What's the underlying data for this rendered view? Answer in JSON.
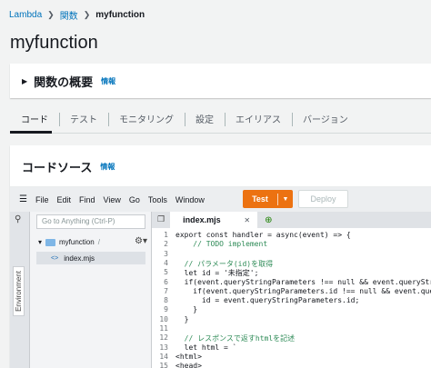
{
  "breadcrumb": {
    "root": "Lambda",
    "functions": "関数",
    "current": "myfunction"
  },
  "page_title": "myfunction",
  "overview": {
    "title": "関数の概要",
    "info": "情報"
  },
  "tabs": [
    "コード",
    "テスト",
    "モニタリング",
    "設定",
    "エイリアス",
    "バージョン"
  ],
  "code_source": {
    "title": "コードソース",
    "info": "情報"
  },
  "ide": {
    "menu": [
      "File",
      "Edit",
      "Find",
      "View",
      "Go",
      "Tools",
      "Window"
    ],
    "test_label": "Test",
    "deploy_label": "Deploy",
    "goto_placeholder": "Go to Anything (Ctrl-P)",
    "environment_label": "Environment",
    "folder_name": "myfunction",
    "folder_slash": "/",
    "file_name": "index.mjs",
    "open_tab": "index.mjs"
  },
  "code_lines": [
    {
      "n": "1",
      "text": "export const handler = async(event) => {"
    },
    {
      "n": "2",
      "text": "    // TODO implement"
    },
    {
      "n": "3",
      "text": ""
    },
    {
      "n": "4",
      "text": "  // パラメータ(id)を取得"
    },
    {
      "n": "5",
      "text": "  let id = '未指定';"
    },
    {
      "n": "6",
      "text": "  if(event.queryStringParameters !== null && event.queryStri"
    },
    {
      "n": "7",
      "text": "    if(event.queryStringParameters.id !== null && event.queryS"
    },
    {
      "n": "8",
      "text": "      id = event.queryStringParameters.id;"
    },
    {
      "n": "9",
      "text": "    }"
    },
    {
      "n": "10",
      "text": "  }"
    },
    {
      "n": "11",
      "text": ""
    },
    {
      "n": "12",
      "text": "  // レスポンスで返すhtmlを記述"
    },
    {
      "n": "13",
      "text": "  let html = `"
    },
    {
      "n": "14",
      "text": "<html>"
    },
    {
      "n": "15",
      "text": "<head>"
    }
  ]
}
